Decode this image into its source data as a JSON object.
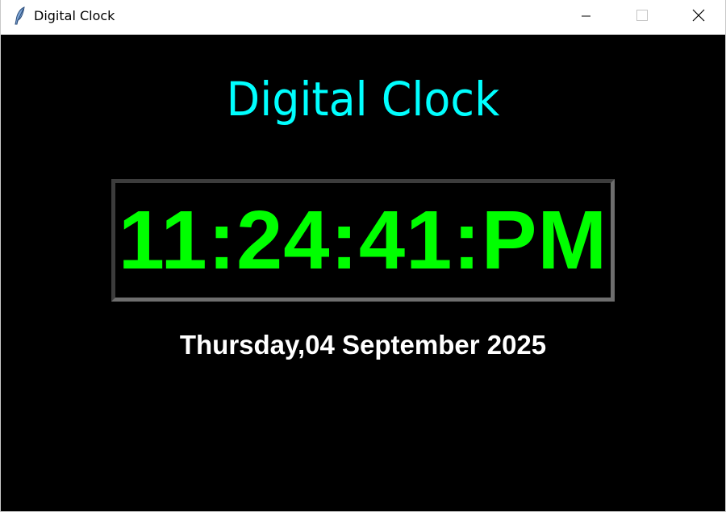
{
  "window": {
    "title": "Digital Clock",
    "app_icon": "feather-icon",
    "controls": {
      "minimize_icon": "minimize-icon",
      "maximize_icon": "maximize-icon",
      "close_icon": "close-icon"
    }
  },
  "clock": {
    "heading": "Digital Clock",
    "time": "11:24:41:PM",
    "date": "Thursday,04 September 2025"
  },
  "colors": {
    "background": "#000000",
    "heading": "#00ffff",
    "time": "#00ff00",
    "date": "#ffffff",
    "frame": "#555555"
  }
}
